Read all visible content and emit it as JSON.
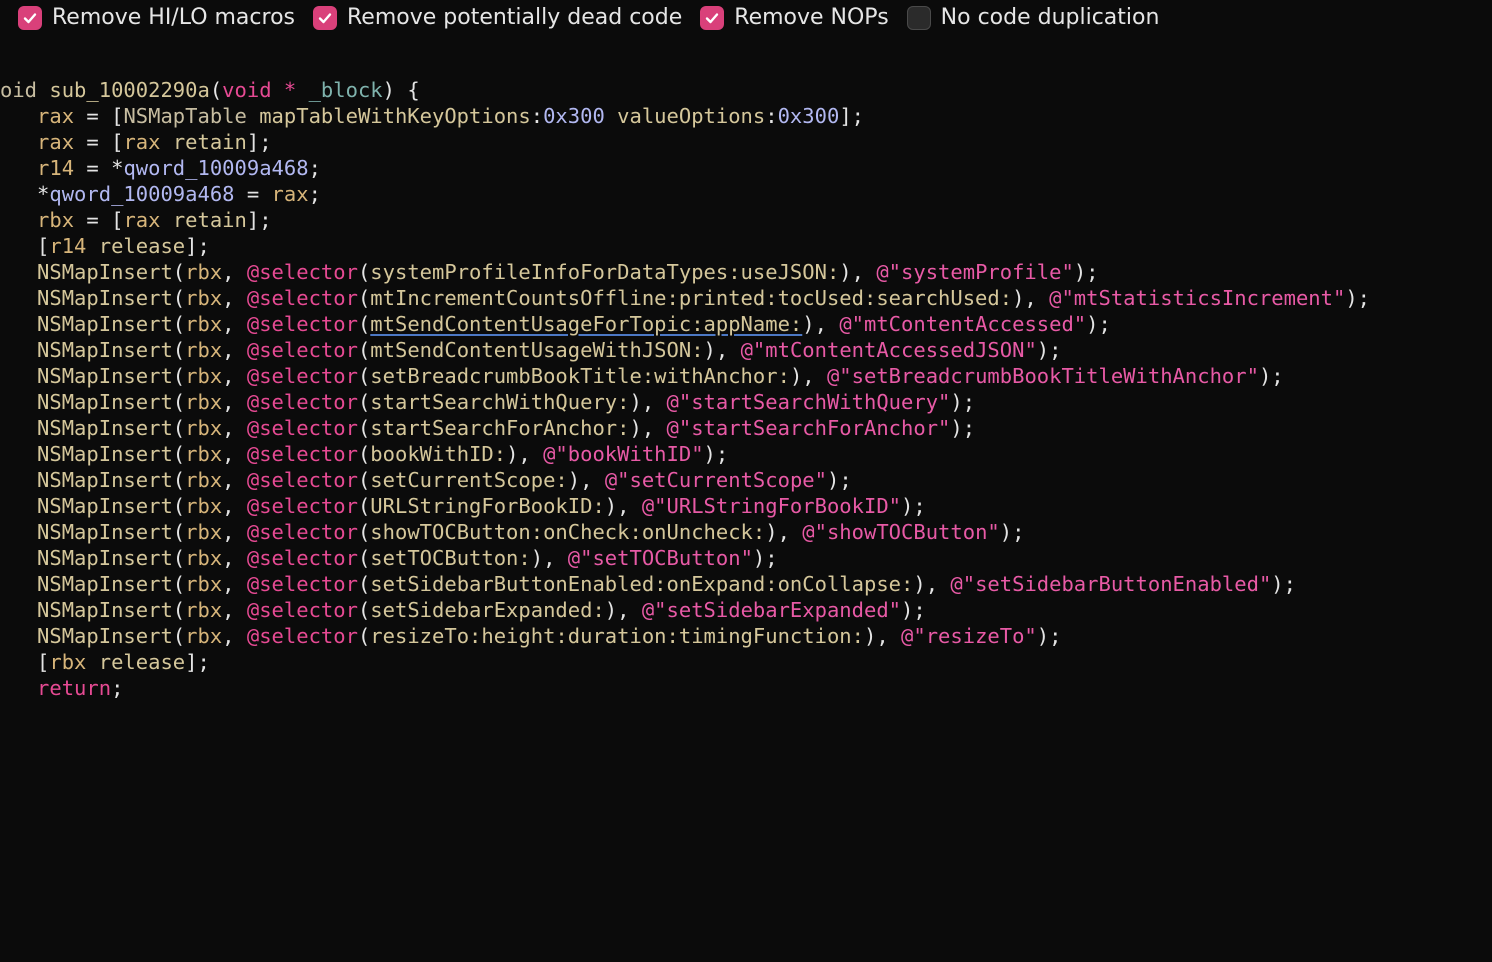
{
  "options": [
    {
      "label": "Remove HI/LO macros",
      "checked": true
    },
    {
      "label": "Remove potentially dead code",
      "checked": true
    },
    {
      "label": "Remove NOPs",
      "checked": true
    },
    {
      "label": "No code duplication",
      "checked": false
    }
  ],
  "colors": {
    "background": "#0b0b0b",
    "checkbox_checked": "#d9407a",
    "keyword": "#e64a93",
    "string": "#e85aa6",
    "register": "#d7b57a",
    "number": "#b2b8f1"
  },
  "code": [
    [
      [
        "ty",
        "oid "
      ],
      [
        "sy",
        "sub_10002290a"
      ],
      [
        "p",
        "("
      ],
      [
        "kw",
        "void"
      ],
      [
        "p",
        " "
      ],
      [
        "kw",
        "*"
      ],
      [
        "p",
        " "
      ],
      [
        "pr",
        "_block"
      ],
      [
        "p",
        ") {"
      ]
    ],
    [
      [
        "p",
        "   "
      ],
      [
        "rg",
        "rax"
      ],
      [
        "p",
        " = ["
      ],
      [
        "ty",
        "NSMapTable"
      ],
      [
        "p",
        " "
      ],
      [
        "sy",
        "mapTableWithKeyOptions"
      ],
      [
        "p",
        ":"
      ],
      [
        "nm",
        "0x300"
      ],
      [
        "p",
        " "
      ],
      [
        "sy",
        "valueOptions"
      ],
      [
        "p",
        ":"
      ],
      [
        "nm",
        "0x300"
      ],
      [
        "p",
        "];"
      ]
    ],
    [
      [
        "p",
        "   "
      ],
      [
        "rg",
        "rax"
      ],
      [
        "p",
        " = ["
      ],
      [
        "rg",
        "rax"
      ],
      [
        "p",
        " "
      ],
      [
        "sy",
        "retain"
      ],
      [
        "p",
        "];"
      ]
    ],
    [
      [
        "p",
        "   "
      ],
      [
        "rg",
        "r14"
      ],
      [
        "p",
        " = *"
      ],
      [
        "gl",
        "qword_10009a468"
      ],
      [
        "p",
        ";"
      ]
    ],
    [
      [
        "p",
        "   *"
      ],
      [
        "gl",
        "qword_10009a468"
      ],
      [
        "p",
        " = "
      ],
      [
        "rg",
        "rax"
      ],
      [
        "p",
        ";"
      ]
    ],
    [
      [
        "p",
        "   "
      ],
      [
        "rg",
        "rbx"
      ],
      [
        "p",
        " = ["
      ],
      [
        "rg",
        "rax"
      ],
      [
        "p",
        " "
      ],
      [
        "sy",
        "retain"
      ],
      [
        "p",
        "];"
      ]
    ],
    [
      [
        "p",
        "   ["
      ],
      [
        "rg",
        "r14"
      ],
      [
        "p",
        " "
      ],
      [
        "sy",
        "release"
      ],
      [
        "p",
        "];"
      ]
    ],
    [
      [
        "p",
        "   "
      ],
      [
        "sy",
        "NSMapInsert"
      ],
      [
        "p",
        "("
      ],
      [
        "rg",
        "rbx"
      ],
      [
        "p",
        ", "
      ],
      [
        "kw",
        "@selector"
      ],
      [
        "p",
        "("
      ],
      [
        "sy",
        "systemProfileInfoForDataTypes:useJSON:"
      ],
      [
        "p",
        "), "
      ],
      [
        "st",
        "@\"systemProfile\""
      ],
      [
        "p",
        ");"
      ]
    ],
    [
      [
        "p",
        "   "
      ],
      [
        "sy",
        "NSMapInsert"
      ],
      [
        "p",
        "("
      ],
      [
        "rg",
        "rbx"
      ],
      [
        "p",
        ", "
      ],
      [
        "kw",
        "@selector"
      ],
      [
        "p",
        "("
      ],
      [
        "sy",
        "mtIncrementCountsOffline:printed:tocUsed:searchUsed:"
      ],
      [
        "p",
        "), "
      ],
      [
        "st",
        "@\"mtStatisticsIncrement\""
      ],
      [
        "p",
        ");"
      ]
    ],
    [
      [
        "p",
        "   "
      ],
      [
        "sy",
        "NSMapInsert"
      ],
      [
        "p",
        "("
      ],
      [
        "rg",
        "rbx"
      ],
      [
        "p",
        ", "
      ],
      [
        "kw",
        "@selector"
      ],
      [
        "p",
        "("
      ],
      [
        "link",
        "mtSendContentUsageForTopic:appName:"
      ],
      [
        "p",
        "), "
      ],
      [
        "st",
        "@\"mtContentAccessed\""
      ],
      [
        "p",
        ");"
      ]
    ],
    [
      [
        "p",
        "   "
      ],
      [
        "sy",
        "NSMapInsert"
      ],
      [
        "p",
        "("
      ],
      [
        "rg",
        "rbx"
      ],
      [
        "p",
        ", "
      ],
      [
        "kw",
        "@selector"
      ],
      [
        "p",
        "("
      ],
      [
        "sy",
        "mtSendContentUsageWithJSON:"
      ],
      [
        "p",
        "), "
      ],
      [
        "st",
        "@\"mtContentAccessedJSON\""
      ],
      [
        "p",
        ");"
      ]
    ],
    [
      [
        "p",
        "   "
      ],
      [
        "sy",
        "NSMapInsert"
      ],
      [
        "p",
        "("
      ],
      [
        "rg",
        "rbx"
      ],
      [
        "p",
        ", "
      ],
      [
        "kw",
        "@selector"
      ],
      [
        "p",
        "("
      ],
      [
        "sy",
        "setBreadcrumbBookTitle:withAnchor:"
      ],
      [
        "p",
        "), "
      ],
      [
        "st",
        "@\"setBreadcrumbBookTitleWithAnchor\""
      ],
      [
        "p",
        ");"
      ]
    ],
    [
      [
        "p",
        "   "
      ],
      [
        "sy",
        "NSMapInsert"
      ],
      [
        "p",
        "("
      ],
      [
        "rg",
        "rbx"
      ],
      [
        "p",
        ", "
      ],
      [
        "kw",
        "@selector"
      ],
      [
        "p",
        "("
      ],
      [
        "sy",
        "startSearchWithQuery:"
      ],
      [
        "p",
        "), "
      ],
      [
        "st",
        "@\"startSearchWithQuery\""
      ],
      [
        "p",
        ");"
      ]
    ],
    [
      [
        "p",
        "   "
      ],
      [
        "sy",
        "NSMapInsert"
      ],
      [
        "p",
        "("
      ],
      [
        "rg",
        "rbx"
      ],
      [
        "p",
        ", "
      ],
      [
        "kw",
        "@selector"
      ],
      [
        "p",
        "("
      ],
      [
        "sy",
        "startSearchForAnchor:"
      ],
      [
        "p",
        "), "
      ],
      [
        "st",
        "@\"startSearchForAnchor\""
      ],
      [
        "p",
        ");"
      ]
    ],
    [
      [
        "p",
        "   "
      ],
      [
        "sy",
        "NSMapInsert"
      ],
      [
        "p",
        "("
      ],
      [
        "rg",
        "rbx"
      ],
      [
        "p",
        ", "
      ],
      [
        "kw",
        "@selector"
      ],
      [
        "p",
        "("
      ],
      [
        "sy",
        "bookWithID:"
      ],
      [
        "p",
        "), "
      ],
      [
        "st",
        "@\"bookWithID\""
      ],
      [
        "p",
        ");"
      ]
    ],
    [
      [
        "p",
        "   "
      ],
      [
        "sy",
        "NSMapInsert"
      ],
      [
        "p",
        "("
      ],
      [
        "rg",
        "rbx"
      ],
      [
        "p",
        ", "
      ],
      [
        "kw",
        "@selector"
      ],
      [
        "p",
        "("
      ],
      [
        "sy",
        "setCurrentScope:"
      ],
      [
        "p",
        "), "
      ],
      [
        "st",
        "@\"setCurrentScope\""
      ],
      [
        "p",
        ");"
      ]
    ],
    [
      [
        "p",
        "   "
      ],
      [
        "sy",
        "NSMapInsert"
      ],
      [
        "p",
        "("
      ],
      [
        "rg",
        "rbx"
      ],
      [
        "p",
        ", "
      ],
      [
        "kw",
        "@selector"
      ],
      [
        "p",
        "("
      ],
      [
        "sy",
        "URLStringForBookID:"
      ],
      [
        "p",
        "), "
      ],
      [
        "st",
        "@\"URLStringForBookID\""
      ],
      [
        "p",
        ");"
      ]
    ],
    [
      [
        "p",
        "   "
      ],
      [
        "sy",
        "NSMapInsert"
      ],
      [
        "p",
        "("
      ],
      [
        "rg",
        "rbx"
      ],
      [
        "p",
        ", "
      ],
      [
        "kw",
        "@selector"
      ],
      [
        "p",
        "("
      ],
      [
        "sy",
        "showTOCButton:onCheck:onUncheck:"
      ],
      [
        "p",
        "), "
      ],
      [
        "st",
        "@\"showTOCButton\""
      ],
      [
        "p",
        ");"
      ]
    ],
    [
      [
        "p",
        "   "
      ],
      [
        "sy",
        "NSMapInsert"
      ],
      [
        "p",
        "("
      ],
      [
        "rg",
        "rbx"
      ],
      [
        "p",
        ", "
      ],
      [
        "kw",
        "@selector"
      ],
      [
        "p",
        "("
      ],
      [
        "sy",
        "setTOCButton:"
      ],
      [
        "p",
        "), "
      ],
      [
        "st",
        "@\"setTOCButton\""
      ],
      [
        "p",
        ");"
      ]
    ],
    [
      [
        "p",
        "   "
      ],
      [
        "sy",
        "NSMapInsert"
      ],
      [
        "p",
        "("
      ],
      [
        "rg",
        "rbx"
      ],
      [
        "p",
        ", "
      ],
      [
        "kw",
        "@selector"
      ],
      [
        "p",
        "("
      ],
      [
        "sy",
        "setSidebarButtonEnabled:onExpand:onCollapse:"
      ],
      [
        "p",
        "), "
      ],
      [
        "st",
        "@\"setSidebarButtonEnabled\""
      ],
      [
        "p",
        ");"
      ]
    ],
    [
      [
        "p",
        "   "
      ],
      [
        "sy",
        "NSMapInsert"
      ],
      [
        "p",
        "("
      ],
      [
        "rg",
        "rbx"
      ],
      [
        "p",
        ", "
      ],
      [
        "kw",
        "@selector"
      ],
      [
        "p",
        "("
      ],
      [
        "sy",
        "setSidebarExpanded:"
      ],
      [
        "p",
        "), "
      ],
      [
        "st",
        "@\"setSidebarExpanded\""
      ],
      [
        "p",
        ");"
      ]
    ],
    [
      [
        "p",
        "   "
      ],
      [
        "sy",
        "NSMapInsert"
      ],
      [
        "p",
        "("
      ],
      [
        "rg",
        "rbx"
      ],
      [
        "p",
        ", "
      ],
      [
        "kw",
        "@selector"
      ],
      [
        "p",
        "("
      ],
      [
        "sy",
        "resizeTo:height:duration:timingFunction:"
      ],
      [
        "p",
        "), "
      ],
      [
        "st",
        "@\"resizeTo\""
      ],
      [
        "p",
        ");"
      ]
    ],
    [
      [
        "p",
        "   ["
      ],
      [
        "rg",
        "rbx"
      ],
      [
        "p",
        " "
      ],
      [
        "sy",
        "release"
      ],
      [
        "p",
        "];"
      ]
    ],
    [
      [
        "p",
        "   "
      ],
      [
        "kw",
        "return"
      ],
      [
        "p",
        ";"
      ]
    ]
  ]
}
